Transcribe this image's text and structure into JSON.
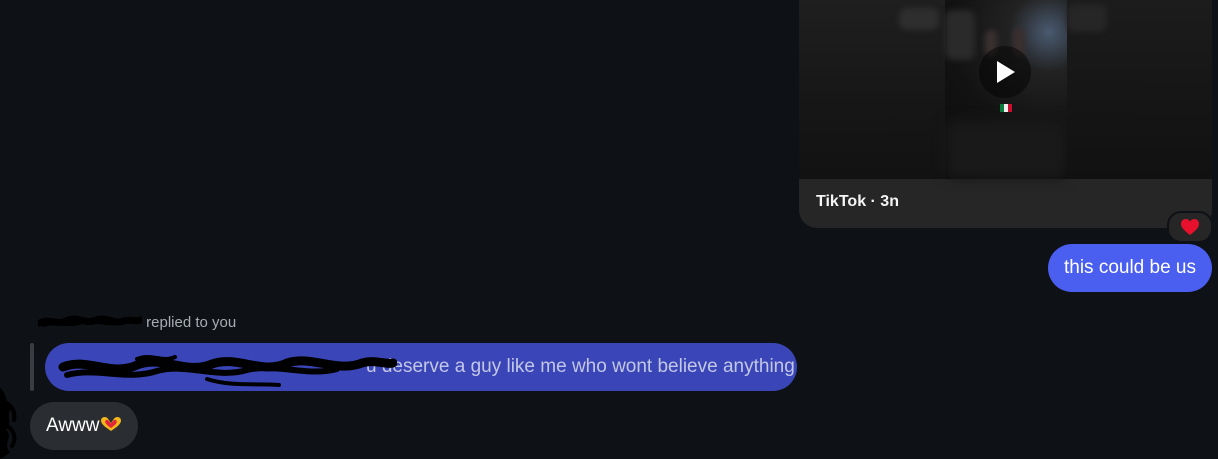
{
  "tiktok_card": {
    "caption": "TikTok · 3n",
    "thumbnail_icons": [
      "play-icon",
      "mexico-flag-icon"
    ]
  },
  "reaction": {
    "emoji": "❤️"
  },
  "outgoing_message": {
    "text": "this could be us"
  },
  "reply_context": {
    "label": "replied to you",
    "quoted_text": "u deserve a guy like me who wont believe anything"
  },
  "incoming_message": {
    "text": "Awww",
    "emoji_icon": "heart-hands-icon"
  },
  "colors": {
    "background": "#0e1116",
    "outgoing_bubble": "#4a5ef0",
    "quoted_bubble": "#3a46b8",
    "incoming_bubble": "#2a2d31",
    "card": "#262626"
  }
}
